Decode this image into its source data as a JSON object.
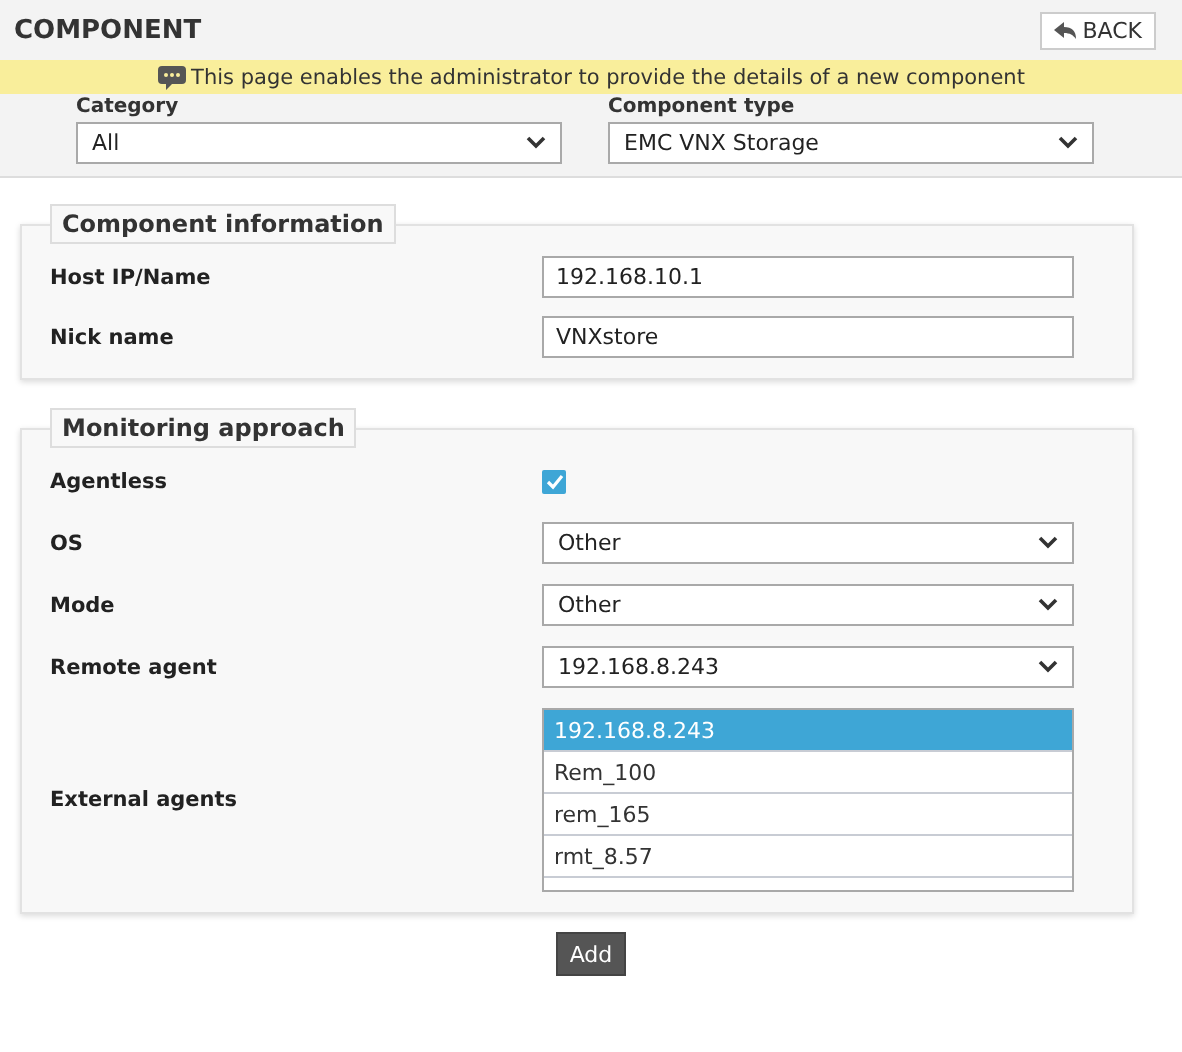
{
  "header": {
    "title": "COMPONENT",
    "back_button": "BACK"
  },
  "banner": {
    "message": "This page enables the administrator to provide the details of a new component"
  },
  "filters": [
    {
      "label": "Category",
      "value": "All"
    },
    {
      "label": "Component type",
      "value": "EMC VNX Storage"
    }
  ],
  "sections": [
    {
      "title": "Component information",
      "fields": [
        {
          "kind": "text",
          "label": "Host IP/Name",
          "value": "192.168.10.1"
        },
        {
          "kind": "text",
          "label": "Nick name",
          "value": "VNXstore"
        }
      ]
    },
    {
      "title": "Monitoring approach",
      "fields": [
        {
          "kind": "checkbox",
          "label": "Agentless",
          "checked": true
        },
        {
          "kind": "select",
          "label": "OS",
          "value": "Other"
        },
        {
          "kind": "select",
          "label": "Mode",
          "value": "Other"
        },
        {
          "kind": "select",
          "label": "Remote agent",
          "value": "192.168.8.243"
        },
        {
          "kind": "listbox",
          "label": "External agents",
          "options": [
            {
              "label": "192.168.8.243",
              "selected": true
            },
            {
              "label": "Rem_100",
              "selected": false
            },
            {
              "label": "rem_165",
              "selected": false
            },
            {
              "label": "rmt_8.57",
              "selected": false
            }
          ]
        }
      ]
    }
  ],
  "submit_button": "Add"
}
